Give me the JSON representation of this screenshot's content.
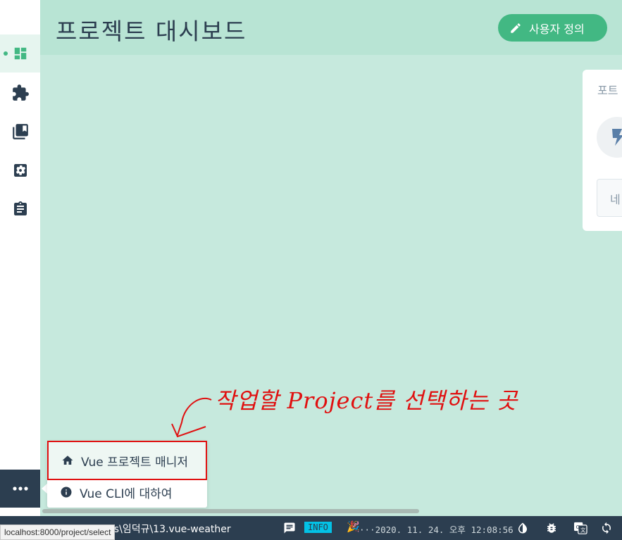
{
  "header": {
    "title": "프로젝트 대시보드",
    "customize_label": "사용자 정의"
  },
  "sidebar": {
    "items": [
      {
        "name": "dashboard",
        "icon": "dashboard-icon",
        "active": true
      },
      {
        "name": "plugins",
        "icon": "puzzle-icon",
        "active": false
      },
      {
        "name": "dependencies",
        "icon": "library-icon",
        "active": false
      },
      {
        "name": "configuration",
        "icon": "gear-icon",
        "active": false
      },
      {
        "name": "tasks",
        "icon": "clipboard-icon",
        "active": false
      }
    ],
    "more_icon": "more-icon"
  },
  "widget": {
    "title": "포트",
    "box_text": "네"
  },
  "annotation": {
    "text": "작업할 Project를 선택하는 곳",
    "color": "#e01010"
  },
  "popup_menu": {
    "items": [
      {
        "label": "Vue 프로젝트 매니저",
        "icon": "home-icon"
      },
      {
        "label": "Vue CLI에 대하여",
        "icon": "info-icon"
      }
    ]
  },
  "statusbar": {
    "path": "C:\\...\\Documents\\임덕규\\13.vue-weather",
    "info_badge": "INFO",
    "log": "···2020. 11. 24. 오후 12:08:56"
  },
  "url_tooltip": "localhost:8000/project/select",
  "colors": {
    "accent": "#42b883",
    "dark": "#2c3e50",
    "background": "#c6e9dd",
    "header": "#b8e4d4",
    "info_badge": "#03c2e6"
  }
}
